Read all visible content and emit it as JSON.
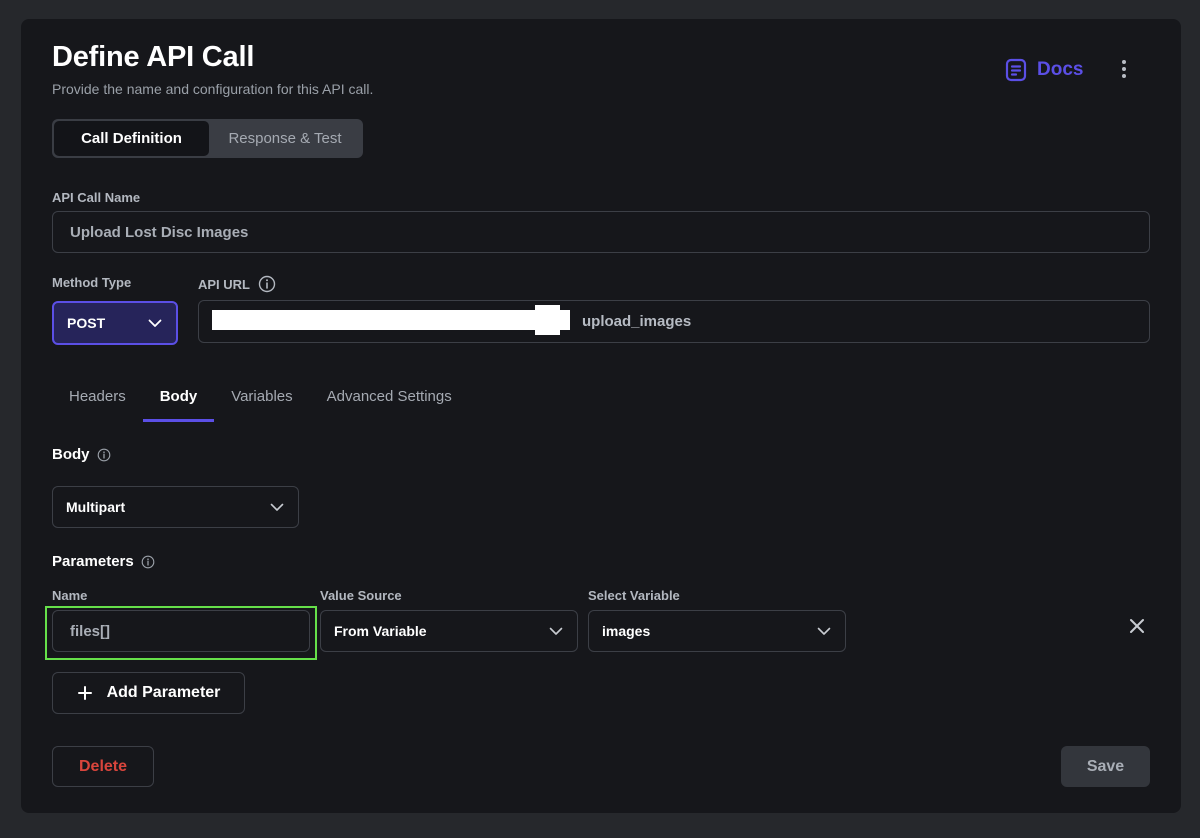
{
  "header": {
    "title": "Define API Call",
    "subtitle": "Provide the name and configuration for this API call.",
    "docs_label": "Docs"
  },
  "mode_tabs": [
    {
      "label": "Call Definition",
      "active": true
    },
    {
      "label": "Response & Test",
      "active": false
    }
  ],
  "api_call_name": {
    "label": "API Call Name",
    "value": "Upload Lost Disc Images"
  },
  "method_type": {
    "label": "Method Type",
    "value": "POST"
  },
  "api_url": {
    "label": "API URL",
    "visible_suffix": "upload_images"
  },
  "config_tabs": [
    {
      "label": "Headers",
      "active": false
    },
    {
      "label": "Body",
      "active": true
    },
    {
      "label": "Variables",
      "active": false
    },
    {
      "label": "Advanced Settings",
      "active": false
    }
  ],
  "body": {
    "label": "Body",
    "type_value": "Multipart"
  },
  "parameters": {
    "label": "Parameters",
    "columns": {
      "name": "Name",
      "value_source": "Value Source",
      "select_variable": "Select Variable"
    },
    "rows": [
      {
        "name": "files[]",
        "value_source": "From Variable",
        "variable": "images"
      }
    ],
    "add_label": "Add Parameter"
  },
  "footer": {
    "delete_label": "Delete",
    "save_label": "Save"
  },
  "colors": {
    "accent": "#5b4fe6",
    "danger": "#d9453c",
    "highlight": "#66e04a",
    "panel": "#16171b",
    "background": "#26282c"
  }
}
